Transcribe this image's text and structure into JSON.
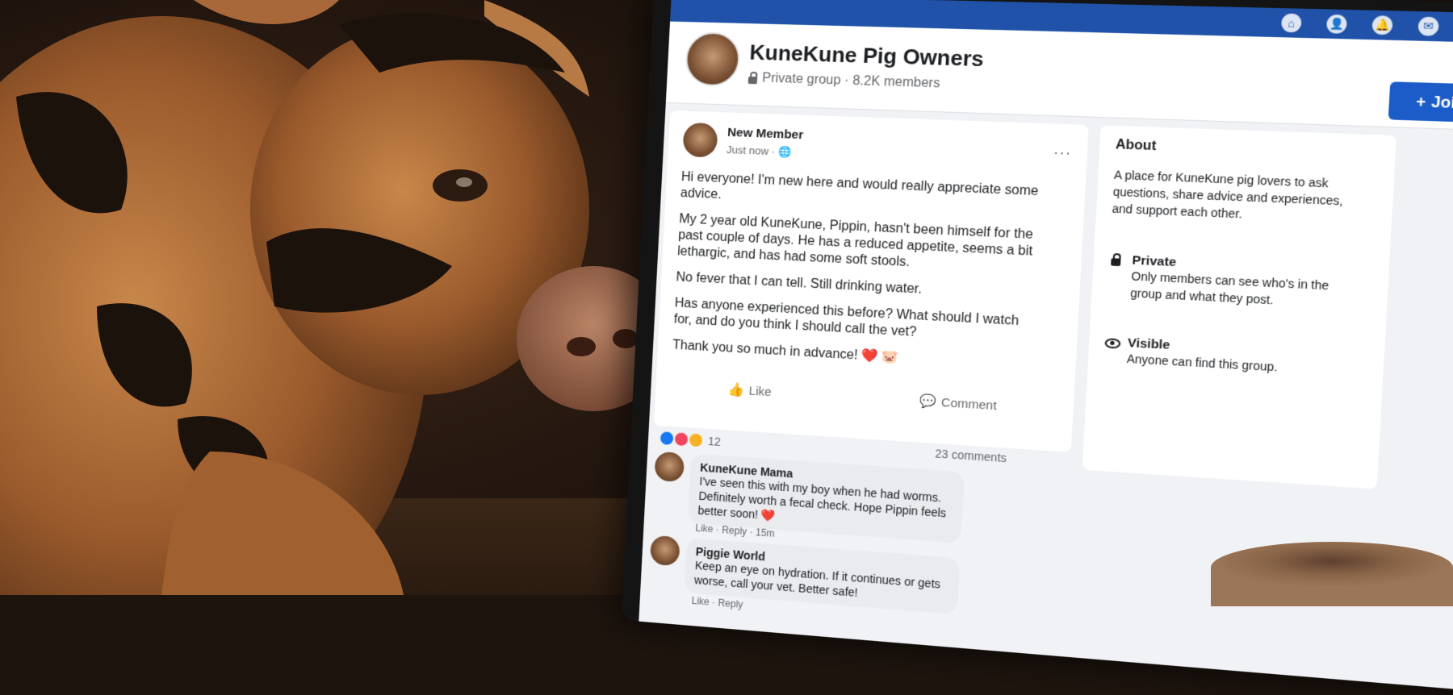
{
  "group": {
    "name": "KuneKune Pig Owners",
    "meta": "Private group · 8.2K members",
    "join_label": "Join"
  },
  "post": {
    "author": "New Member",
    "time": "Just now",
    "paragraphs": [
      "Hi everyone! I'm new here and would really appreciate some advice.",
      "My 2 year old KuneKune, Pippin, hasn't been himself for the past couple of days. He has a reduced appetite, seems a bit lethargic, and has had some soft stools.",
      "No fever that I can tell. Still drinking water.",
      "Has anyone experienced this before? What should I watch for, and do you think I should call the vet?",
      "Thank you so much in advance! ❤️ 🐷"
    ],
    "like_label": "Like",
    "comment_label": "Comment",
    "reaction_count": "12",
    "comments_count": "23 comments"
  },
  "comments": [
    {
      "author": "KuneKune Mama",
      "text": "I've seen this with my boy when he had worms. Definitely worth a fecal check. Hope Pippin feels better soon! ❤️",
      "meta": "Like · Reply · 15m"
    },
    {
      "author": "Piggie World",
      "text": "Keep an eye on hydration. If it continues or gets worse, call your vet. Better safe!",
      "meta": "Like · Reply"
    }
  ],
  "about": {
    "heading": "About",
    "description": "A place for KuneKune pig lovers to ask questions, share advice and experiences, and support each other.",
    "private_title": "Private",
    "private_text": "Only members can see who's in the group and what they post.",
    "visible_title": "Visible",
    "visible_text": "Anyone can find this group."
  },
  "colors": {
    "facebook_blue": "#1f52a8",
    "join_blue": "#1b5cc9",
    "heart_red": "#e0242d"
  }
}
